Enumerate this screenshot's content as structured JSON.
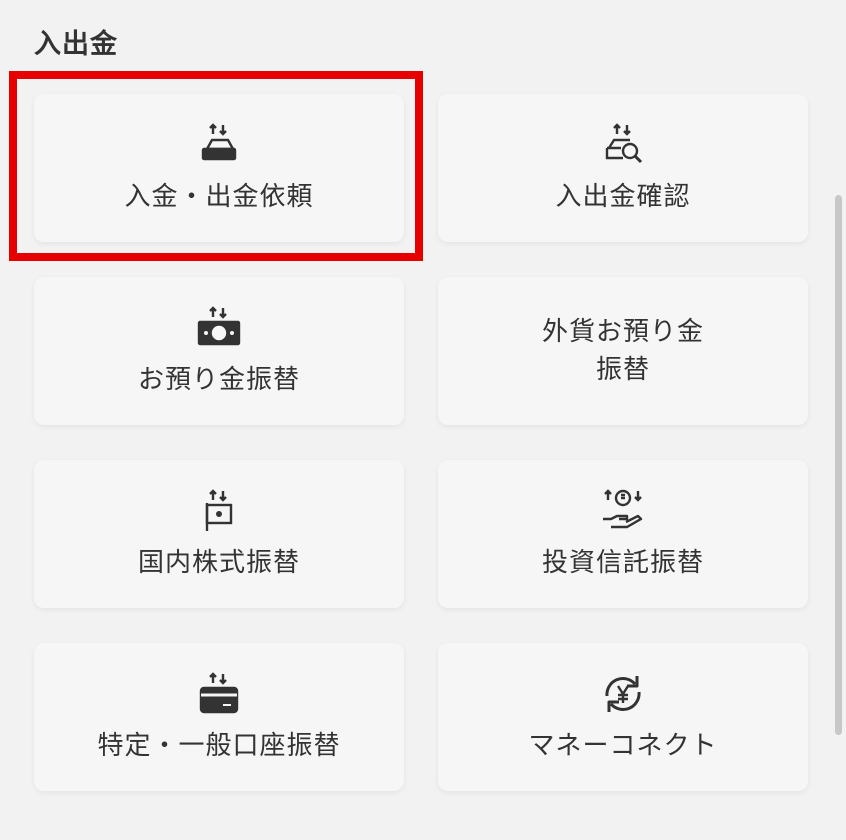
{
  "section": {
    "title": "入出金"
  },
  "tiles": [
    {
      "label": "入金・出金依頼",
      "icon": "deposit-withdraw-icon"
    },
    {
      "label": "入出金確認",
      "icon": "deposit-check-icon"
    },
    {
      "label": "お預り金振替",
      "icon": "cash-transfer-icon"
    },
    {
      "label": "外貨お預り金\n振替",
      "icon": ""
    },
    {
      "label": "国内株式振替",
      "icon": "domestic-stock-transfer-icon"
    },
    {
      "label": "投資信託振替",
      "icon": "investment-trust-transfer-icon"
    },
    {
      "label": "特定・一般口座振替",
      "icon": "account-card-transfer-icon"
    },
    {
      "label": "マネーコネクト",
      "icon": "yen-exchange-icon"
    }
  ],
  "colors": {
    "highlight": "#e60000",
    "icon": "#333333",
    "tile": "#f6f6f6"
  }
}
